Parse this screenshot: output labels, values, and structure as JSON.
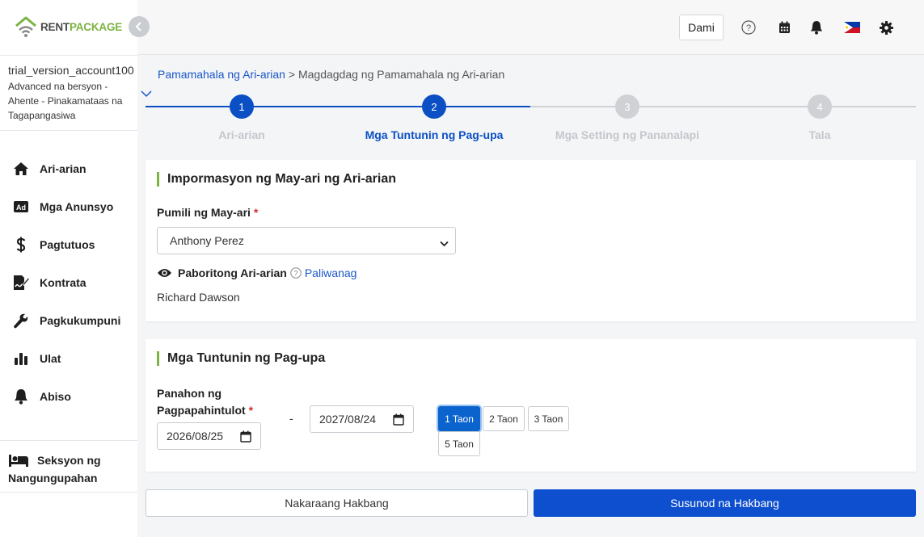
{
  "brand": {
    "name_part1": "RENT",
    "name_part2": "PACKAGE",
    "color_primary": "#7cb342",
    "color_dark": "#4a4a4a"
  },
  "account": {
    "name": "trial_version_account100",
    "details": [
      "Advanced na bersyon -",
      "Ahente - Pinakamataas na",
      "Tagapangasiwa"
    ]
  },
  "sidebar": {
    "items": [
      {
        "label": "Ari-arian",
        "icon": "home-icon"
      },
      {
        "label": "Mga Anunsyo",
        "icon": "ad-icon"
      },
      {
        "label": "Pagtutuos",
        "icon": "dollar-icon"
      },
      {
        "label": "Kontrata",
        "icon": "contract-icon"
      },
      {
        "label": "Pagkukumpuni",
        "icon": "wrench-icon"
      },
      {
        "label": "Ulat",
        "icon": "bar-chart-icon"
      },
      {
        "label": "Abiso",
        "icon": "bell-icon"
      }
    ],
    "tenant_section": {
      "line1": "Seksyon ng",
      "line2": "Nangungupahan",
      "icon": "bed-icon"
    }
  },
  "topbar": {
    "more_label": "Dami",
    "icons": [
      "help-icon",
      "calendar-icon",
      "notification-bell-icon",
      "philippines-flag-icon",
      "settings-gear-icon"
    ]
  },
  "breadcrumb": {
    "parent": "Pamamahala ng Ari-arian",
    "separator": ">",
    "current": "Magdagdag ng Pamamahala ng Ari-arian"
  },
  "stepper": {
    "steps": [
      {
        "number": "1",
        "label": "Ari-arian",
        "state": "done"
      },
      {
        "number": "2",
        "label": "Mga Tuntunin ng Pag-upa",
        "state": "active"
      },
      {
        "number": "3",
        "label": "Mga Setting ng Pananalapi",
        "state": "pending"
      },
      {
        "number": "4",
        "label": "Tala",
        "state": "pending"
      }
    ],
    "active_color": "#0b4fc4",
    "inactive_color": "#cfd1d4"
  },
  "owner_section": {
    "title": "Impormasyon ng May-ari ng Ari-arian",
    "select_label": "Pumili ng May-ari",
    "required_mark": "*",
    "selected_owner": "Anthony Perez",
    "favorite_label": "Paboritong Ari-arian",
    "explain_link": "Paliwanag",
    "favorite_value": "Richard Dawson"
  },
  "lease_section": {
    "title": "Mga Tuntunin ng Pag-upa",
    "period_label_line1": "Panahon ng",
    "period_label_line2": "Pagpapahintulot",
    "required_mark": "*",
    "start_date": "2026/08/25",
    "dash": "-",
    "end_date": "2027/08/24",
    "year_options": [
      "1 Taon",
      "2 Taon",
      "3 Taon",
      "5 Taon"
    ],
    "selected_year": "1 Taon"
  },
  "footer": {
    "prev_label": "Nakaraang Hakbang",
    "next_label": "Susunod na Hakbang",
    "next_color": "#0d4fcf"
  }
}
